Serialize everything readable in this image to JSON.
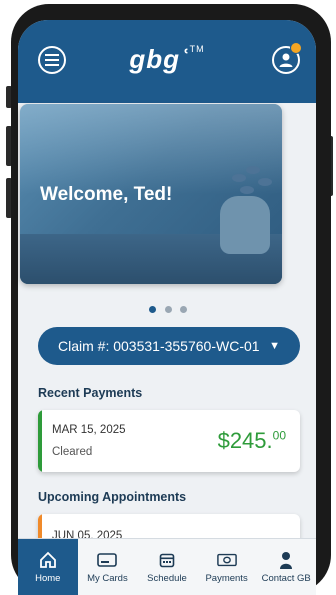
{
  "app": {
    "logo": "gbgʿ",
    "logo_mark": "TM"
  },
  "header": {
    "menu_icon": "menu-icon",
    "profile_icon": "profile-icon"
  },
  "hero": {
    "greeting": "Welcome, Ted!"
  },
  "carousel": {
    "count": 3,
    "active": 0
  },
  "claim": {
    "label": "Claim #: 003531-355760-WC-01",
    "caret": "▼"
  },
  "recent_payments": {
    "title": "Recent Payments",
    "items": [
      {
        "date": "MAR 15, 2025",
        "status": "Cleared",
        "amount_main": "$245.",
        "amount_cents": "00"
      }
    ]
  },
  "upcoming_appointments": {
    "title": "Upcoming Appointments",
    "items": [
      {
        "date": "JUN 05, 2025"
      }
    ]
  },
  "nav": {
    "items": [
      {
        "label": "Home",
        "icon": "home-icon"
      },
      {
        "label": "My Cards",
        "icon": "card-icon"
      },
      {
        "label": "Schedule",
        "icon": "calendar-icon"
      },
      {
        "label": "Payments",
        "icon": "money-icon"
      },
      {
        "label": "Contact GB",
        "icon": "person-icon"
      }
    ]
  },
  "colors": {
    "brand": "#1e5a8c",
    "amount": "#2e9b3a",
    "cleared_bar": "#2e9b3a",
    "appt_bar": "#f08a2a",
    "notif": "#f5a623"
  }
}
